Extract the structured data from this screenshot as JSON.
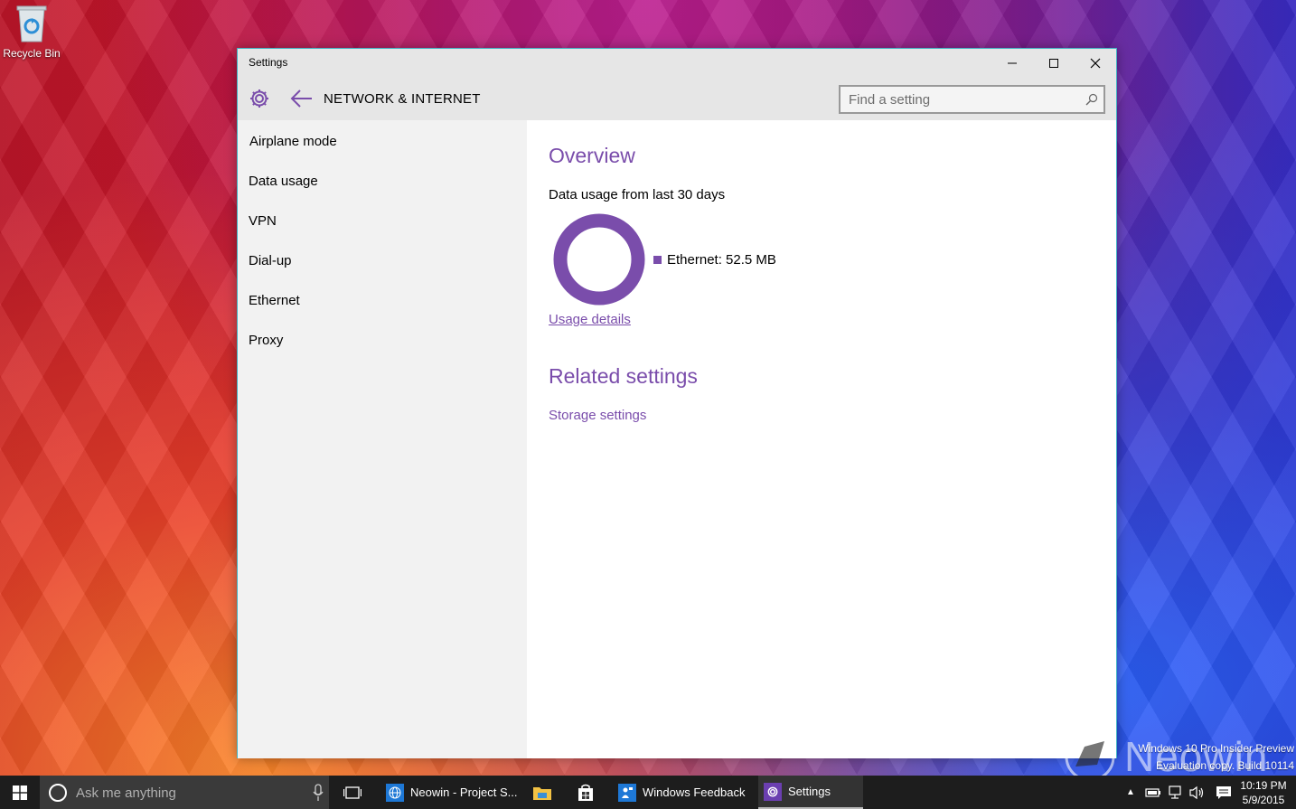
{
  "desktop": {
    "recycle_bin_label": "Recycle Bin",
    "watermark_line1": "Windows 10 Pro Insider Preview",
    "watermark_line2": "Evaluation copy. Build 10114",
    "brand_text": "Neowin"
  },
  "window": {
    "title": "Settings",
    "section_title": "NETWORK & INTERNET",
    "search_placeholder": "Find a setting",
    "accent_color": "#7a4dab"
  },
  "sidebar": {
    "items": [
      {
        "label": "Airplane mode"
      },
      {
        "label": "Data usage"
      },
      {
        "label": "VPN"
      },
      {
        "label": "Dial-up"
      },
      {
        "label": "Ethernet"
      },
      {
        "label": "Proxy"
      }
    ]
  },
  "content": {
    "overview_heading": "Overview",
    "data_usage_caption": "Data usage from last 30 days",
    "legend_label": "Ethernet: 52.5 MB",
    "usage_details_link": "Usage details",
    "related_heading": "Related settings",
    "storage_link": "Storage settings"
  },
  "taskbar": {
    "search_placeholder": "Ask me anything",
    "apps": [
      {
        "label": "Neowin - Project S..."
      },
      {
        "label": "Windows Feedback"
      },
      {
        "label": "Settings"
      }
    ],
    "time": "10:19 PM",
    "date": "5/9/2015"
  }
}
